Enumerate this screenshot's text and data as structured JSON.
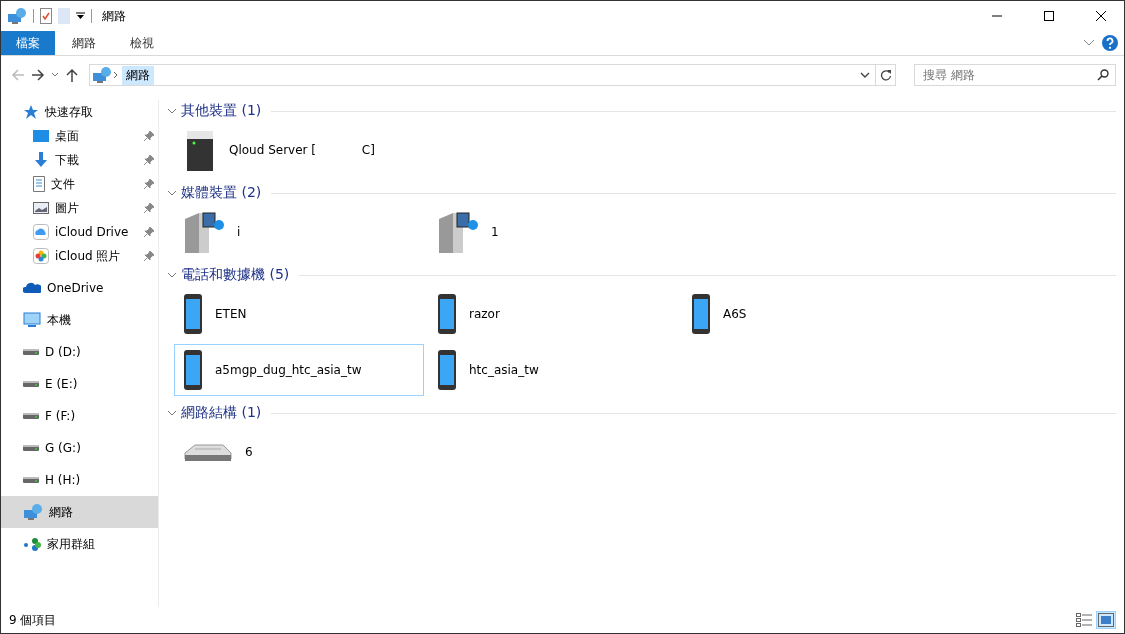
{
  "window": {
    "title": "網路"
  },
  "ribbon_tabs": [
    {
      "label": "檔案",
      "kind": "file",
      "selected": false
    },
    {
      "label": "網路",
      "kind": "tab",
      "selected": false
    },
    {
      "label": "檢視",
      "kind": "tab",
      "selected": false
    }
  ],
  "address": {
    "path": [
      "網路"
    ]
  },
  "search": {
    "placeholder": "搜尋 網路"
  },
  "sidebar": {
    "items": [
      {
        "label": "快速存取",
        "kind": "star",
        "selected": false,
        "children": [
          {
            "label": "桌面",
            "kind": "desktop",
            "pinned": true,
            "selected": false
          },
          {
            "label": "下載",
            "kind": "download",
            "pinned": true,
            "selected": false
          },
          {
            "label": "文件",
            "kind": "document",
            "pinned": true,
            "selected": false
          },
          {
            "label": "圖片",
            "kind": "picture",
            "pinned": true,
            "selected": false
          },
          {
            "label": "iCloud Drive",
            "kind": "cloud",
            "pinned": true,
            "selected": false
          },
          {
            "label": "iCloud 照片",
            "kind": "photos",
            "pinned": true,
            "selected": false
          }
        ]
      },
      {
        "label": "OneDrive",
        "kind": "onedrive",
        "selected": false
      },
      {
        "label": "本機",
        "kind": "pc",
        "selected": false
      },
      {
        "label": "D (D:)",
        "kind": "drive",
        "selected": false
      },
      {
        "label": "E (E:)",
        "kind": "drive",
        "selected": false
      },
      {
        "label": "F (F:)",
        "kind": "drive",
        "selected": false
      },
      {
        "label": "G (G:)",
        "kind": "drive",
        "selected": false
      },
      {
        "label": "H (H:)",
        "kind": "drive",
        "selected": false
      },
      {
        "label": "網路",
        "kind": "network",
        "selected": true
      },
      {
        "label": "家用群組",
        "kind": "homegroup",
        "selected": false
      }
    ]
  },
  "groups": [
    {
      "title": "其他裝置 (1)",
      "expanded": true,
      "items": [
        {
          "name": "Qloud Server [            C]",
          "kind": "server",
          "selected": false
        }
      ]
    },
    {
      "title": "媒體裝置 (2)",
      "expanded": true,
      "items": [
        {
          "name": "i",
          "kind": "media",
          "selected": false
        },
        {
          "name": "1",
          "kind": "media",
          "selected": false
        }
      ]
    },
    {
      "title": "電話和數據機 (5)",
      "expanded": true,
      "items": [
        {
          "name": "ETEN",
          "kind": "phone",
          "selected": false
        },
        {
          "name": "razor",
          "kind": "phone",
          "selected": false
        },
        {
          "name": "A6S",
          "kind": "phone",
          "selected": false
        },
        {
          "name": "a5mgp_dug_htc_asia_tw",
          "kind": "phone",
          "selected": true
        },
        {
          "name": "htc_asia_tw",
          "kind": "phone",
          "selected": false
        }
      ]
    },
    {
      "title": "網路結構 (1)",
      "expanded": true,
      "items": [
        {
          "name": "6",
          "kind": "router",
          "selected": false
        }
      ]
    }
  ],
  "status_bar": {
    "count": "9 個項目",
    "views": [
      {
        "kind": "details",
        "selected": false
      },
      {
        "kind": "tiles",
        "selected": true
      }
    ]
  }
}
